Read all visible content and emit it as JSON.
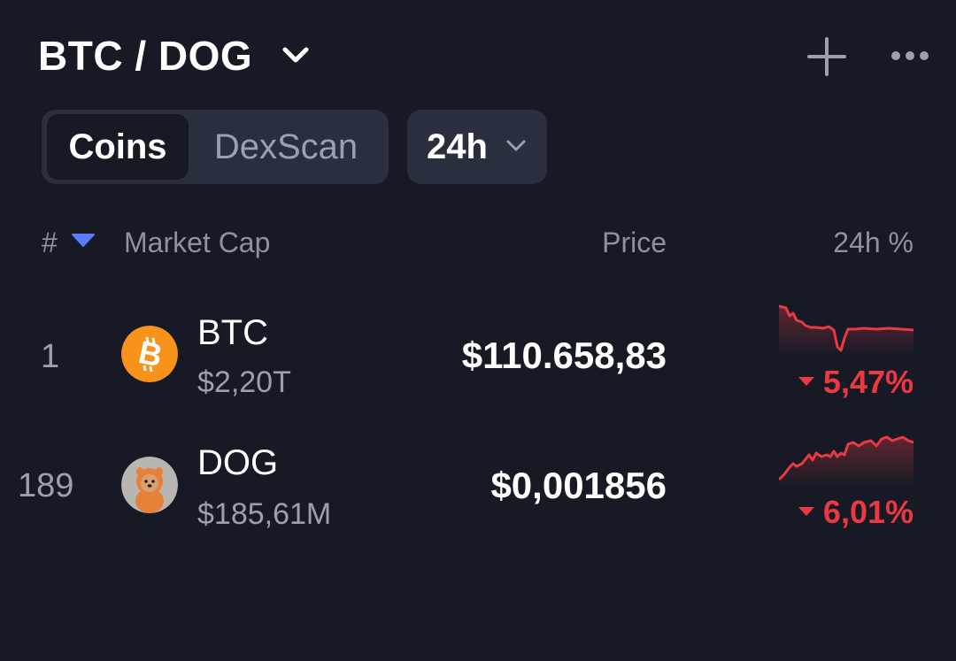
{
  "header": {
    "title": "BTC / DOG",
    "title_dropdown_icon": "chevron-down-icon",
    "add_icon": "plus-icon",
    "more_icon": "more-horizontal-icon"
  },
  "tabs": {
    "items": [
      {
        "label": "Coins",
        "active": true
      },
      {
        "label": "DexScan",
        "active": false
      }
    ]
  },
  "timeframe": {
    "value": "24h"
  },
  "columns": {
    "rank": "#",
    "market_cap": "Market Cap",
    "price": "Price",
    "change": "24h %"
  },
  "rows": [
    {
      "rank": "1",
      "symbol": "BTC",
      "market_cap": "$2,20T",
      "price": "$110.658,83",
      "change": "5,47%",
      "direction": "down",
      "icon": "bitcoin-icon"
    },
    {
      "rank": "189",
      "symbol": "DOG",
      "market_cap": "$185,61M",
      "price": "$0,001856",
      "change": "6,01%",
      "direction": "down",
      "icon": "dog-avatar-icon"
    }
  ],
  "colors": {
    "background": "#171a25",
    "negative": "#ea3943",
    "accent_sort": "#5b7cff",
    "bitcoin": "#f7931a"
  }
}
